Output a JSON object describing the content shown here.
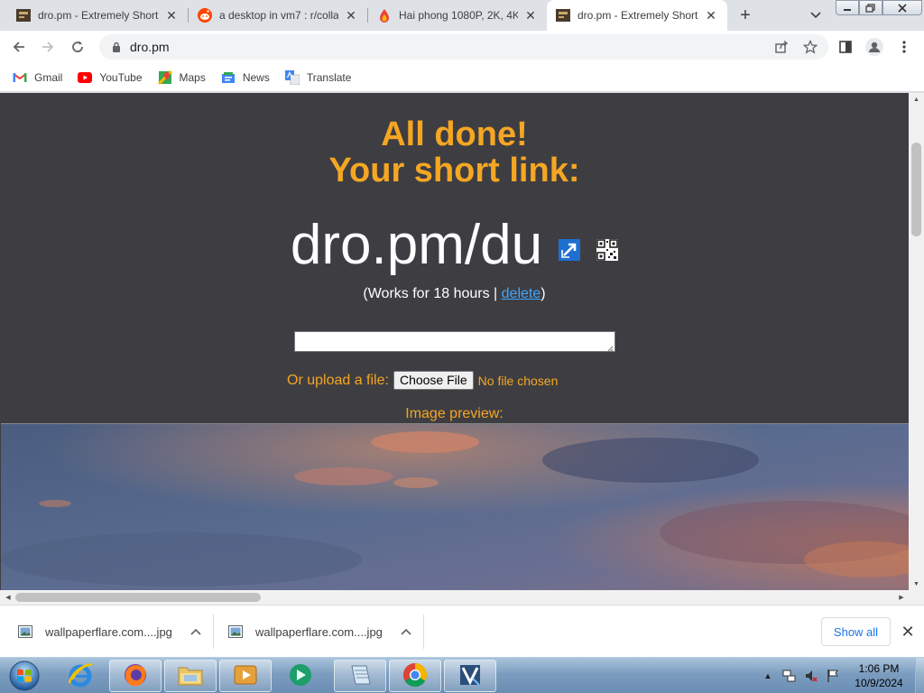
{
  "browser": {
    "tabs": [
      {
        "title": "dro.pm - Extremely Short",
        "favicon": "dropm-favicon",
        "active": false
      },
      {
        "title": "a desktop in vm7 : r/colla",
        "favicon": "reddit-favicon",
        "active": false
      },
      {
        "title": "Hai phong 1080P, 2K, 4K",
        "favicon": "wallpaperflare-favicon",
        "active": false
      },
      {
        "title": "dro.pm - Extremely Short",
        "favicon": "dropm-favicon",
        "active": true
      }
    ],
    "new_tab": "+",
    "close_glyph": "✕",
    "address": "dro.pm",
    "bookmarks": [
      {
        "label": "Gmail",
        "icon": "gmail-icon"
      },
      {
        "label": "YouTube",
        "icon": "youtube-icon"
      },
      {
        "label": "Maps",
        "icon": "maps-icon"
      },
      {
        "label": "News",
        "icon": "news-icon"
      },
      {
        "label": "Translate",
        "icon": "translate-icon"
      }
    ]
  },
  "page": {
    "headline_line1": "All done!",
    "headline_line2": "Your short link:",
    "short_link": "dro.pm/du",
    "works_prefix": "(Works for 18 hours | ",
    "delete_label": "delete",
    "works_suffix": ")",
    "text_value": "",
    "upload_label": "Or upload a file:",
    "choose_file_label": "Choose File",
    "no_file_label": "No file chosen",
    "preview_label": "Image preview:",
    "colors": {
      "background": "#3e3e42",
      "accent": "#f5a623",
      "link": "#3ea6ff"
    }
  },
  "downloads": {
    "items": [
      {
        "name": "wallpaperflare.com....jpg"
      },
      {
        "name": "wallpaperflare.com....jpg"
      }
    ],
    "show_all_label": "Show all"
  },
  "taskbar": {
    "apps": [
      {
        "name": "internet-explorer"
      },
      {
        "name": "firefox"
      },
      {
        "name": "windows-explorer"
      },
      {
        "name": "media-player"
      },
      {
        "name": "green-app"
      },
      {
        "name": "notepad-app"
      },
      {
        "name": "chrome"
      },
      {
        "name": "video-editor"
      }
    ],
    "clock_time": "1:06 PM",
    "clock_date": "10/9/2024"
  }
}
